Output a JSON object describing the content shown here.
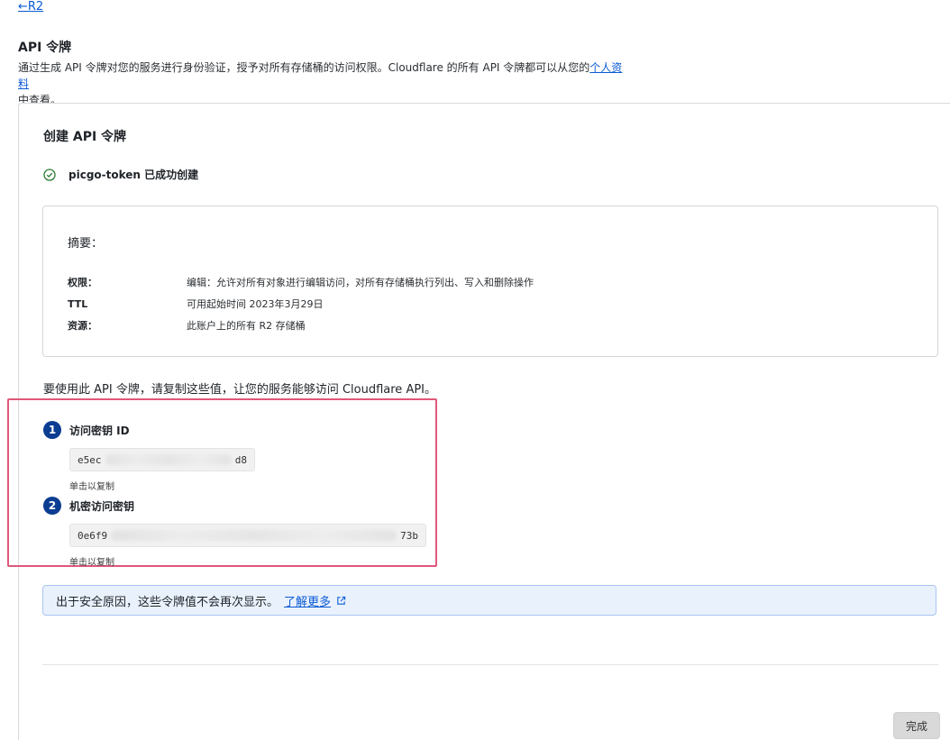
{
  "nav": {
    "back_label": "←R2"
  },
  "header": {
    "title": "API 令牌",
    "description": "通过生成 API 令牌对您的服务进行身份验证，授予对所有存储桶的访问权限。Cloudflare 的所有 API 令牌都可以从您的",
    "profile_link": "个人资料",
    "description_tail": "中查看。"
  },
  "card": {
    "title": "创建 API 令牌",
    "success_message": "picgo-token 已成功创建",
    "summary": {
      "heading": "摘要：",
      "rows": [
        {
          "key": "权限：",
          "value": "编辑：允许对所有对象进行编辑访问，对所有存储桶执行列出、写入和删除操作"
        },
        {
          "key": "TTL",
          "value": "可用起始时间 2023年3月29日"
        },
        {
          "key": "资源：",
          "value": "此账户上的所有 R2 存储桶"
        }
      ]
    },
    "instruction": "要使用此 API 令牌，请复制这些值，让您的服务能够访问 Cloudflare API。",
    "keys": [
      {
        "number": "1",
        "label": "访问密钥 ID",
        "prefix": "e5ec",
        "suffix": "d8",
        "hint": "单击以复制"
      },
      {
        "number": "2",
        "label": "机密访问密钥",
        "prefix": "0e6f9",
        "suffix": "73b",
        "hint": "单击以复制"
      }
    ],
    "banner": {
      "text": "出于安全原因，这些令牌值不会再次显示。",
      "link": "了解更多",
      "link_icon": "external-link-icon"
    },
    "done_label": "完成"
  },
  "colors": {
    "link": "#0a5bd3",
    "step_badge": "#0b3d91",
    "highlight": "#e0577b",
    "banner_bg": "#e9f1fd"
  }
}
